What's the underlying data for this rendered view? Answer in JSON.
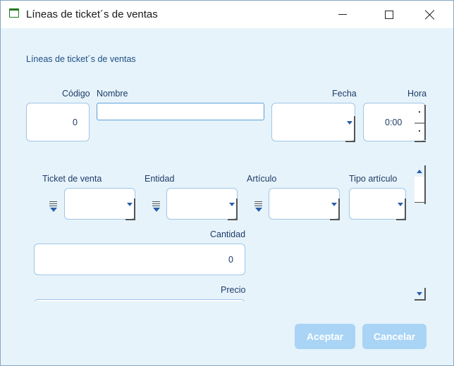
{
  "window": {
    "title": "Líneas de ticket´s de ventas"
  },
  "form": {
    "section_title": "Líneas de ticket´s de ventas",
    "codigo": {
      "label": "Código",
      "value": "0"
    },
    "nombre": {
      "label": "Nombre",
      "value": ""
    },
    "fecha": {
      "label": "Fecha",
      "value": ""
    },
    "hora": {
      "label": "Hora",
      "value": "0:00"
    },
    "ticket": {
      "label": "Ticket de venta",
      "value": ""
    },
    "entidad": {
      "label": "Entidad",
      "value": ""
    },
    "articulo": {
      "label": "Artículo",
      "value": ""
    },
    "tipo_articulo": {
      "label": "Tipo artículo",
      "value": ""
    },
    "cantidad": {
      "label": "Cantidad",
      "value": "0"
    },
    "precio": {
      "label": "Precio"
    }
  },
  "buttons": {
    "accept": "Aceptar",
    "cancel": "Cancelar"
  },
  "colors": {
    "accent": "#1f4e85",
    "button_disabled": "#a9d4f5",
    "background": "#e6f3fb"
  },
  "icons": [
    "window-icon",
    "minimize-icon",
    "maximize-icon",
    "close-icon",
    "list-selector-icon",
    "dropdown-arrow-icon",
    "spin-up-icon",
    "spin-down-icon",
    "scroll-up-icon",
    "scroll-down-icon"
  ]
}
